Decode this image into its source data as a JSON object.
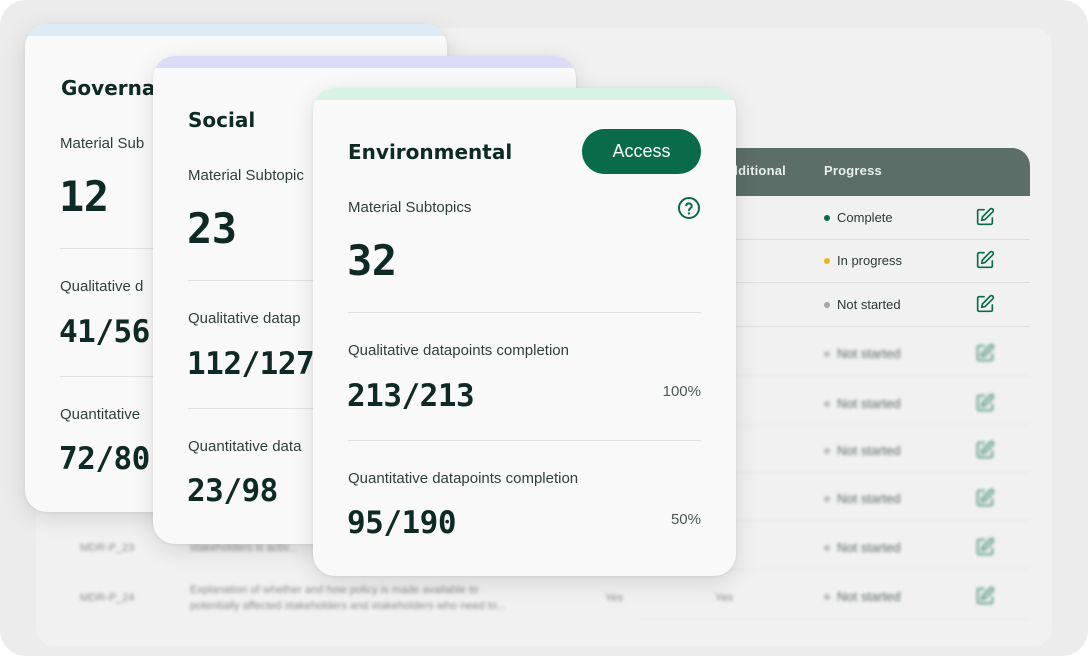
{
  "colors": {
    "accent": "#0a6b4a",
    "governance_band": "#dcebf6",
    "social_band": "#dcdcf6",
    "environmental_band": "#d8f3e6",
    "status_complete": "#0a6b4a",
    "status_in_progress": "#e8b81a",
    "status_not_started": "#a5a5a5"
  },
  "table": {
    "headers": {
      "additional": "dditional",
      "progress": "Progress"
    },
    "rows": [
      {
        "status": "Complete",
        "status_type": "complete"
      },
      {
        "status": "In progress",
        "status_type": "in_progress"
      },
      {
        "status": "Not started",
        "status_type": "not_started"
      },
      {
        "status": "Not started",
        "status_type": "not_started"
      },
      {
        "status": "Not started",
        "status_type": "not_started"
      },
      {
        "status": "Not started",
        "status_type": "not_started"
      },
      {
        "status": "Not started",
        "status_type": "not_started"
      },
      {
        "status": "Not started",
        "status_type": "not_started"
      },
      {
        "status": "Not started",
        "status_type": "not_started"
      }
    ],
    "blurred_rows": [
      {
        "code": "MDR-P_23",
        "text": "stakeholders is activ..."
      },
      {
        "code": "MDR-P_24",
        "text": "Explanation of whether and how policy is made available to",
        "text2": "potentially affected stakeholders and stakeholders who need to...",
        "col3": "Yes",
        "col4": "Yes"
      }
    ]
  },
  "governance": {
    "title": "Governa",
    "subtopics_label": "Material Sub",
    "subtopics_value": "12",
    "qualitative_label": "Qualitative d",
    "qualitative_value": "41/56",
    "quantitative_label": "Quantitative",
    "quantitative_value": "72/80"
  },
  "social": {
    "title": "Social",
    "subtopics_label": "Material Subtopic",
    "subtopics_value": "23",
    "qualitative_label": "Qualitative datap",
    "qualitative_value": "112/127",
    "quantitative_label": "Quantitative data",
    "quantitative_value": "23/98"
  },
  "environmental": {
    "title": "Environmental",
    "access_label": "Access",
    "help_icon": "question-circle-icon",
    "subtopics_label": "Material Subtopics",
    "subtopics_value": "32",
    "qualitative_label": "Qualitative datapoints completion",
    "qualitative_value": "213/213",
    "qualitative_percent": "100%",
    "qualitative_progress": 1.0,
    "quantitative_label": "Quantitative datapoints completion",
    "quantitative_value": "95/190",
    "quantitative_percent": "50%",
    "quantitative_progress": 0.5
  }
}
